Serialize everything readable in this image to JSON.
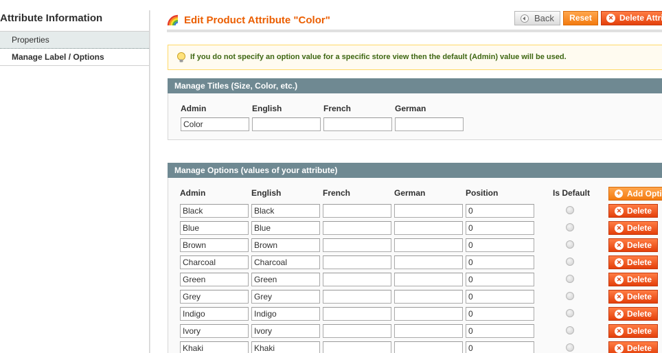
{
  "sidebar": {
    "title": "Attribute Information",
    "tabs": [
      {
        "label": "Properties",
        "active": false
      },
      {
        "label": "Manage Label / Options",
        "active": true
      }
    ]
  },
  "header": {
    "icon": "rainbow-icon",
    "title": "Edit Product Attribute \"Color\"",
    "buttons": {
      "back": "Back",
      "reset": "Reset",
      "delete_attribute": "Delete Attribute"
    }
  },
  "notice": {
    "icon": "lightbulb-icon",
    "text": "If you do not specify an option value for a specific store view then the default (Admin) value will be used."
  },
  "manage_titles": {
    "heading": "Manage Titles (Size, Color, etc.)",
    "columns": [
      "Admin",
      "English",
      "French",
      "German"
    ],
    "values": [
      "Color",
      "",
      "",
      ""
    ]
  },
  "manage_options": {
    "heading": "Manage Options (values of your attribute)",
    "columns": [
      "Admin",
      "English",
      "French",
      "German",
      "Position",
      "Is Default"
    ],
    "add_button": "Add Option",
    "delete_label": "Delete",
    "rows": [
      {
        "admin": "Black",
        "english": "Black",
        "french": "",
        "german": "",
        "position": "0",
        "is_default": false
      },
      {
        "admin": "Blue",
        "english": "Blue",
        "french": "",
        "german": "",
        "position": "0",
        "is_default": false
      },
      {
        "admin": "Brown",
        "english": "Brown",
        "french": "",
        "german": "",
        "position": "0",
        "is_default": false
      },
      {
        "admin": "Charcoal",
        "english": "Charcoal",
        "french": "",
        "german": "",
        "position": "0",
        "is_default": false
      },
      {
        "admin": "Green",
        "english": "Green",
        "french": "",
        "german": "",
        "position": "0",
        "is_default": false
      },
      {
        "admin": "Grey",
        "english": "Grey",
        "french": "",
        "german": "",
        "position": "0",
        "is_default": false
      },
      {
        "admin": "Indigo",
        "english": "Indigo",
        "french": "",
        "german": "",
        "position": "0",
        "is_default": false
      },
      {
        "admin": "Ivory",
        "english": "Ivory",
        "french": "",
        "german": "",
        "position": "0",
        "is_default": false
      },
      {
        "admin": "Khaki",
        "english": "Khaki",
        "french": "",
        "german": "",
        "position": "0",
        "is_default": false
      }
    ]
  },
  "colors": {
    "title_orange": "#eb5e00",
    "section_header": "#6f8992",
    "notice_bg": "#fffbf0",
    "notice_text": "#3d6611",
    "button_orange": "#f37b10",
    "button_red": "#e4400b"
  }
}
